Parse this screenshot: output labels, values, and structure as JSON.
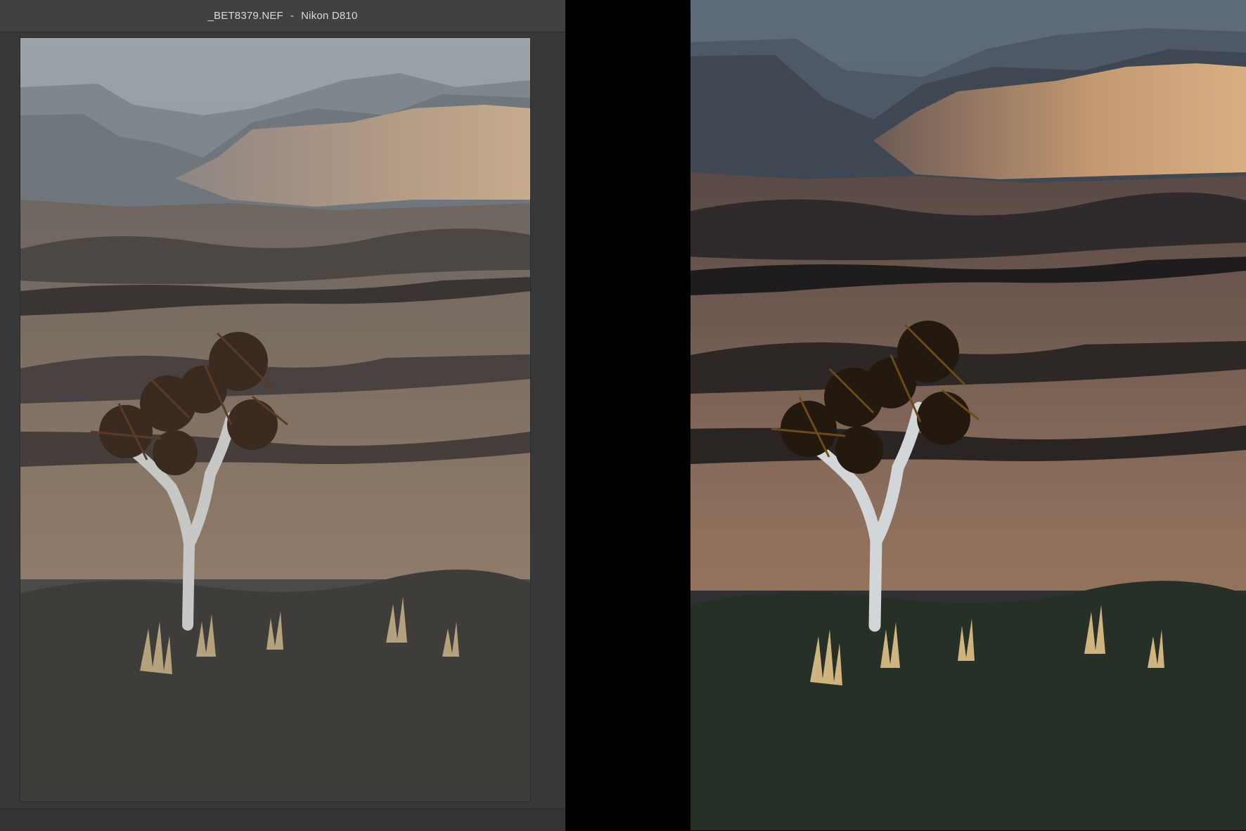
{
  "window": {
    "filename": "_BET8379.NEF",
    "separator": "-",
    "camera": "Nikon D810"
  },
  "images": {
    "before": {
      "description_icon": "landscape-photo-icon",
      "variant": "unedited"
    },
    "after": {
      "description_icon": "landscape-photo-icon",
      "variant": "edited"
    }
  },
  "colors": {
    "window_bg": "#3a3a3a",
    "titlebar_bg": "#414141",
    "title_text": "#d9d9d9",
    "outer_bg": "#000000"
  }
}
